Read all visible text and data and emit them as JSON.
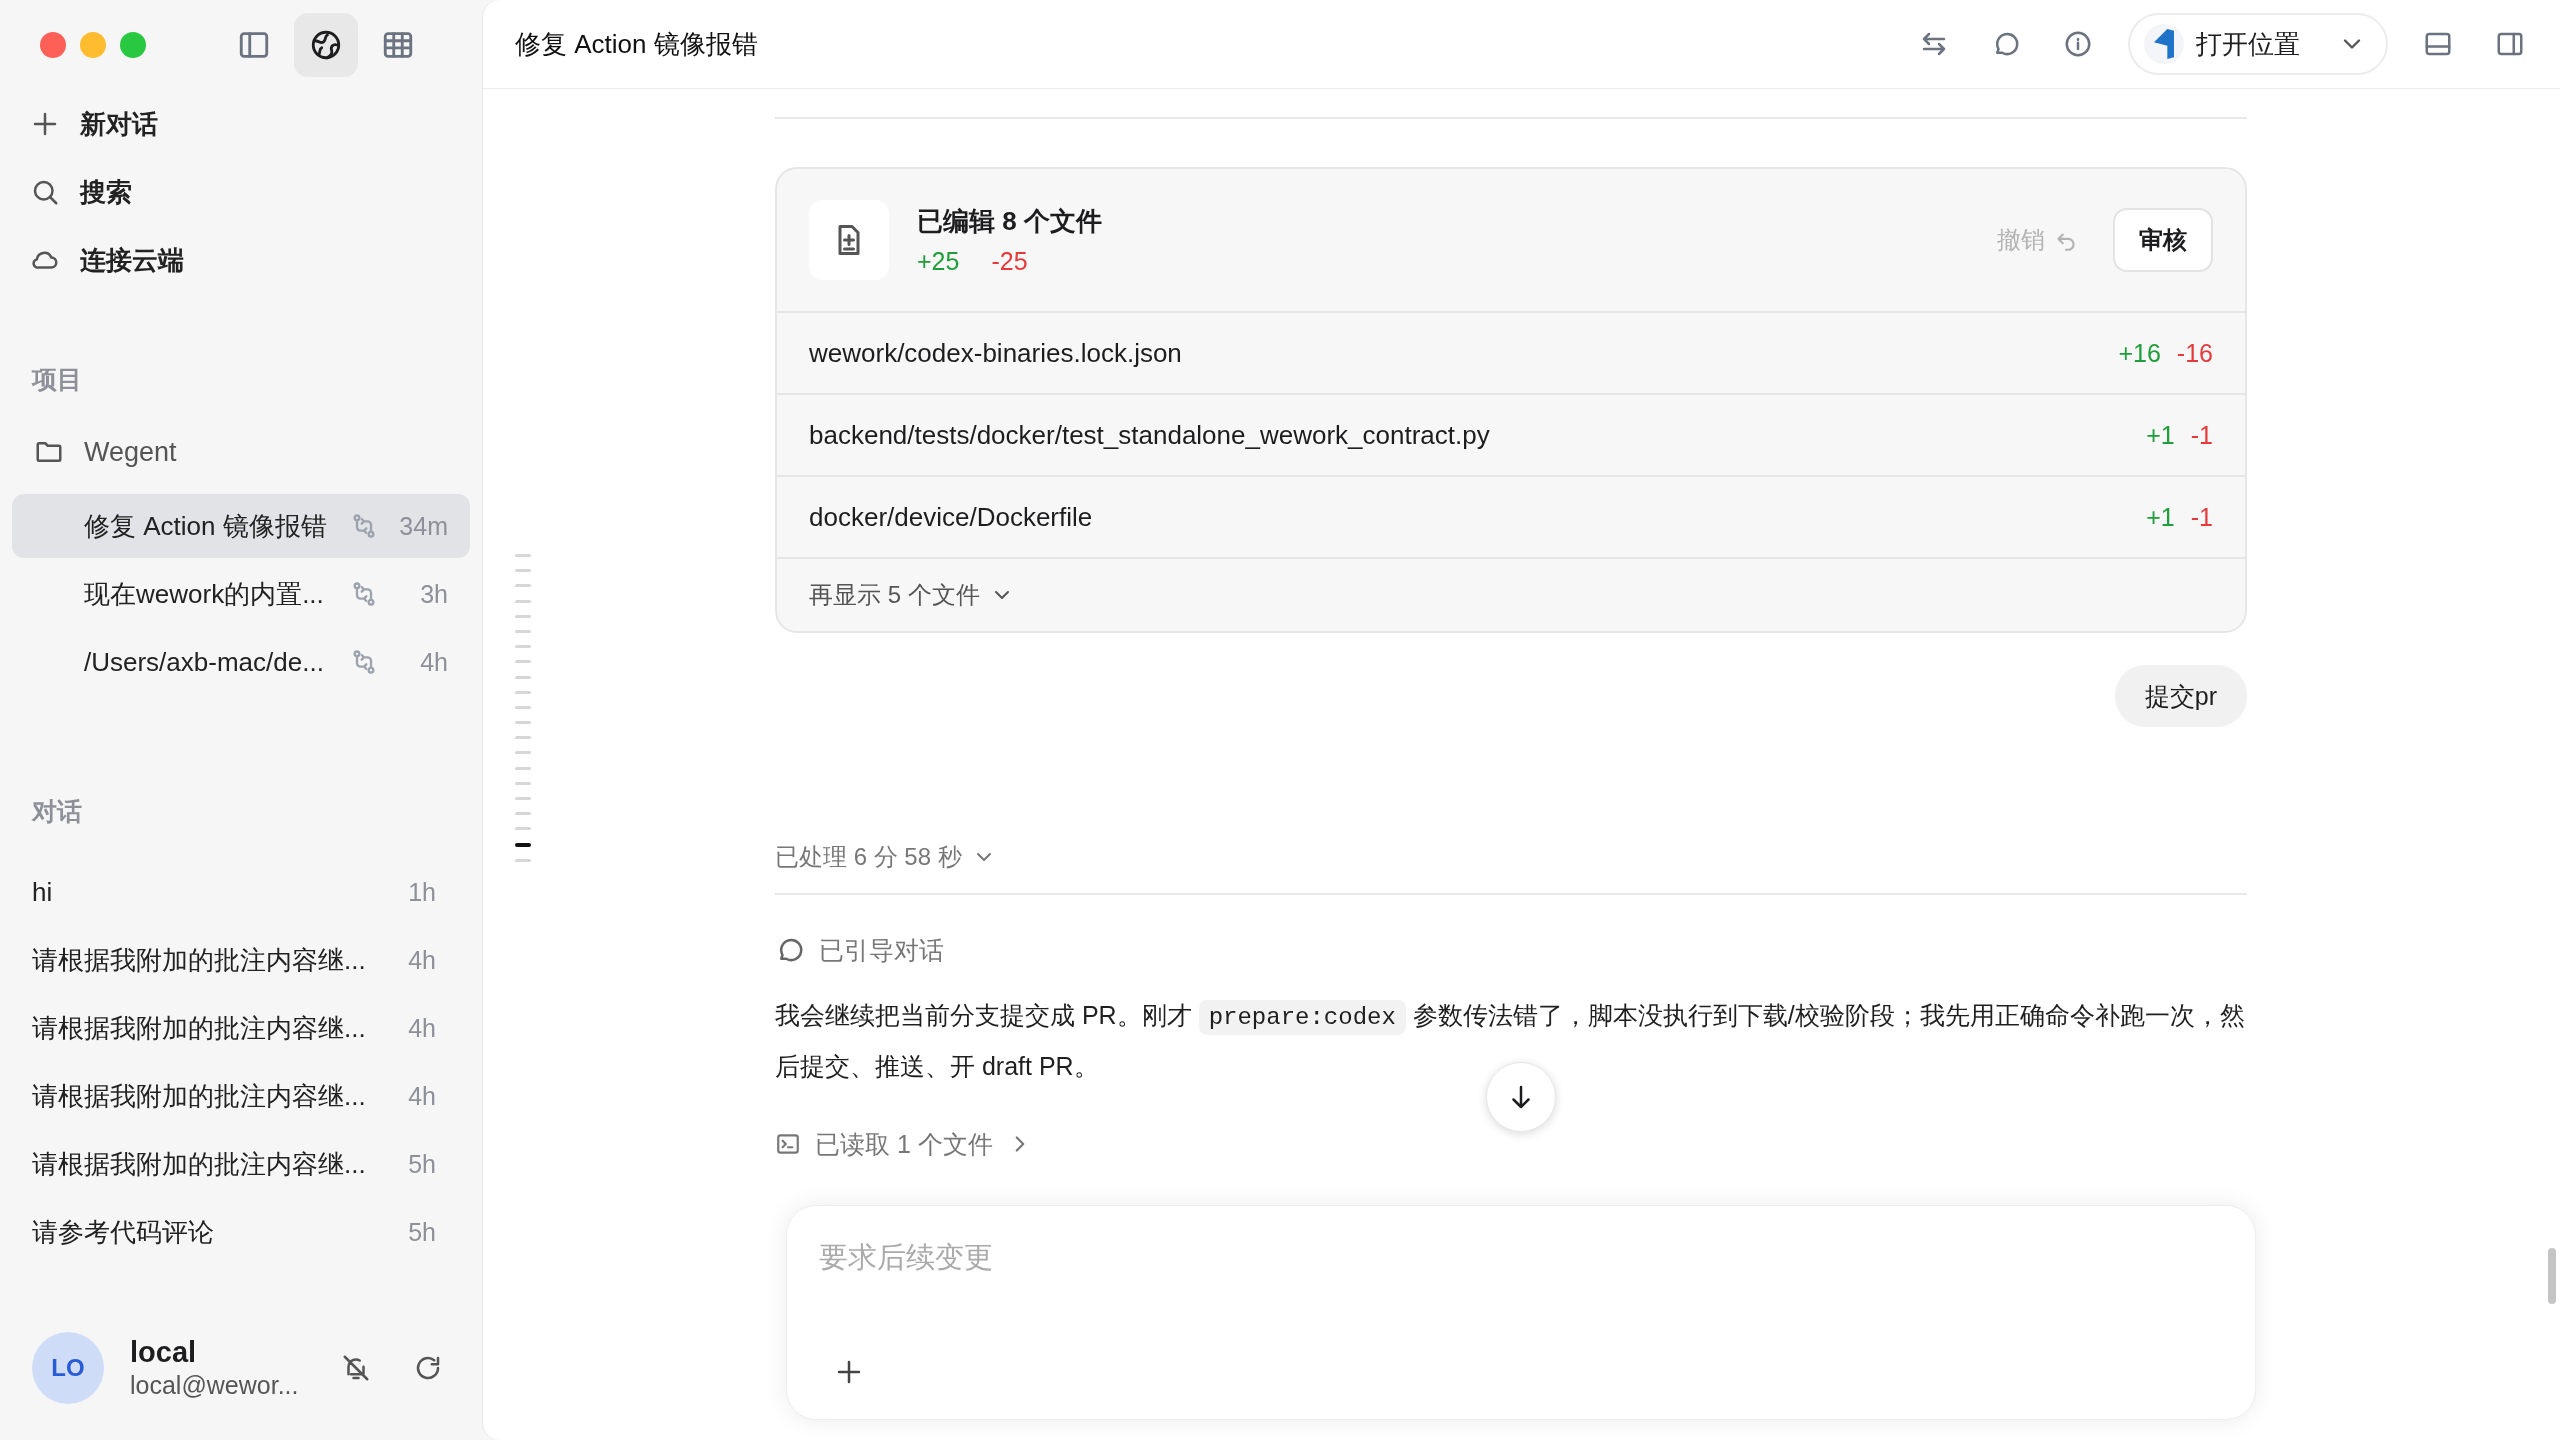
{
  "window": {
    "title": "修复 Action 镜像报错"
  },
  "sidebar": {
    "toolbar": [
      {
        "kind": "panel",
        "selected": false
      },
      {
        "kind": "globe",
        "selected": true
      },
      {
        "kind": "grid",
        "selected": false
      }
    ],
    "nav": [
      {
        "kind": "plus",
        "label": "新对话"
      },
      {
        "kind": "search",
        "label": "搜索"
      },
      {
        "kind": "cloud",
        "label": "连接云端"
      }
    ],
    "projects_heading": "项目",
    "projects": [
      {
        "name": "Wegent",
        "children": [
          {
            "title": "修复 Action 镜像报错",
            "time": "34m",
            "selected": true
          },
          {
            "title": "现在wework的内置...",
            "time": "3h",
            "selected": false
          },
          {
            "title": "/Users/axb-mac/de...",
            "time": "4h",
            "selected": false
          }
        ]
      }
    ],
    "conversations_heading": "对话",
    "conversations": [
      {
        "title": "hi",
        "time": "1h",
        "selected": false
      },
      {
        "title": "请根据我附加的批注内容继...",
        "time": "4h",
        "selected": false
      },
      {
        "title": "请根据我附加的批注内容继...",
        "time": "4h",
        "selected": false
      },
      {
        "title": "请根据我附加的批注内容继...",
        "time": "4h",
        "selected": false
      },
      {
        "title": "请根据我附加的批注内容继...",
        "time": "5h",
        "selected": false
      },
      {
        "title": "请参考代码评论",
        "time": "5h",
        "selected": false
      }
    ],
    "user": {
      "initials": "LO",
      "name": "local",
      "email": "local@wewor..."
    }
  },
  "toolbar": {
    "open_button": {
      "label": "打开位置"
    }
  },
  "edits": {
    "title": "已编辑 8 个文件",
    "added": "+25",
    "removed": "-25",
    "undo": "撤销",
    "review": "审核",
    "files": [
      {
        "path": "wework/codex-binaries.lock.json",
        "added": "+16",
        "removed": "-16"
      },
      {
        "path": "backend/tests/docker/test_standalone_wework_contract.py",
        "added": "+1",
        "removed": "-1"
      },
      {
        "path": "docker/device/Dockerfile",
        "added": "+1",
        "removed": "-1"
      }
    ],
    "more": "再显示 5 个文件"
  },
  "submit_button": "提交pr",
  "processed": "已处理 6 分 58 秒",
  "guided": "已引导对话",
  "message": [
    {
      "kind": "text",
      "text": "我会继续把当前分支提交成 PR。刚才 "
    },
    {
      "kind": "code",
      "text": "prepare:codex"
    },
    {
      "kind": "text",
      "text": " 参数传法错了，脚本没执行到下载/校验阶段；我先用正确命令补跑一次，然后提交、推送、开 draft PR。"
    }
  ],
  "read_files": "已读取 1 个文件",
  "composer": {
    "placeholder": "要求后续变更"
  },
  "timeline": [
    {
      "selected": false
    },
    {
      "selected": false
    },
    {
      "selected": false
    },
    {
      "selected": false
    },
    {
      "selected": false
    },
    {
      "selected": false
    },
    {
      "selected": false
    },
    {
      "selected": false
    },
    {
      "selected": false
    },
    {
      "selected": false
    },
    {
      "selected": false
    },
    {
      "selected": false
    },
    {
      "selected": false
    },
    {
      "selected": false
    },
    {
      "selected": false
    },
    {
      "selected": false
    },
    {
      "selected": false
    },
    {
      "selected": false
    },
    {
      "selected": false
    },
    {
      "selected": true
    },
    {
      "selected": false
    }
  ]
}
